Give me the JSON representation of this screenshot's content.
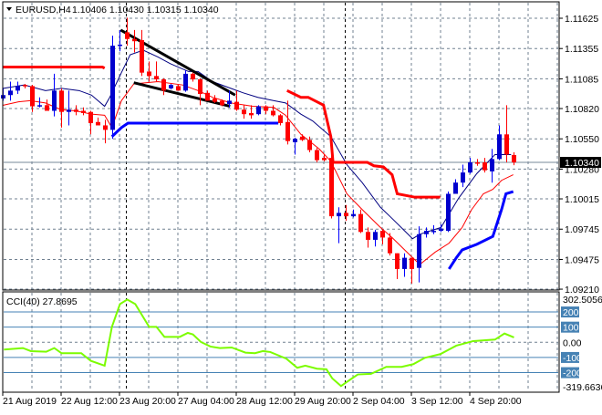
{
  "header": {
    "symbol": "EURUSD,H4",
    "ohlc": "1.10406 1.10430 1.10315 1.10340"
  },
  "price_axis": {
    "ticks": [
      "1.11625",
      "1.11355",
      "1.11085",
      "1.10820",
      "1.10550",
      "1.10280",
      "1.10015",
      "1.09745",
      "1.09475",
      "1.09210"
    ],
    "current_price_label": "1.10340"
  },
  "cci_panel": {
    "label": "CCI(40) 27.8695",
    "max_label": "302.5056",
    "min_label": "-319.6636",
    "level_labels": [
      "200",
      "100",
      "0.00",
      "-100",
      "-200"
    ]
  },
  "time_axis": {
    "labels": [
      "21 Aug 2019",
      "22 Aug 12:00",
      "23 Aug 20:00",
      "27 Aug 04:00",
      "28 Aug 12:00",
      "29 Aug 20:00",
      "2 Sep 04:00",
      "3 Sep 12:00",
      "4 Sep 20:00"
    ]
  },
  "colors": {
    "bull": "#0000CD",
    "bull_wick": "#0000FF",
    "bear": "#FF0000",
    "ma_fast": "#000080",
    "ma_slow": "#FF0000",
    "resistance": "#FF0000",
    "support": "#0000FF",
    "trendline": "#000000",
    "cci": "#7CFC00",
    "cci_levels": "#4682B4",
    "grid": "#708090"
  },
  "chart_data": {
    "type": "candlestick",
    "title": "EURUSD,H4",
    "ylim": [
      1.0921,
      1.11625
    ],
    "y_ticks": [
      1.11625,
      1.11355,
      1.11085,
      1.1082,
      1.1055,
      1.1028,
      1.10015,
      1.09745,
      1.09475,
      1.0921
    ],
    "current_price": 1.1034,
    "period_separators": [
      17,
      47
    ],
    "grid": true,
    "candles_ohlc": [
      [
        1.1091,
        1.11,
        1.1089,
        1.1094
      ],
      [
        1.1094,
        1.1106,
        1.1089,
        1.1098
      ],
      [
        1.1098,
        1.1106,
        1.1095,
        1.1102
      ],
      [
        1.1103,
        1.1104,
        1.11,
        1.1102
      ],
      [
        1.1102,
        1.1103,
        1.1079,
        1.1084
      ],
      [
        1.1084,
        1.1092,
        1.1083,
        1.1085
      ],
      [
        1.1085,
        1.109,
        1.108,
        1.108
      ],
      [
        1.108,
        1.1113,
        1.1075,
        1.1098
      ],
      [
        1.1098,
        1.11,
        1.1065,
        1.1079
      ],
      [
        1.1079,
        1.1098,
        1.1067,
        1.1081
      ],
      [
        1.1081,
        1.1085,
        1.1076,
        1.1079
      ],
      [
        1.108,
        1.1083,
        1.1076,
        1.1078
      ],
      [
        1.1079,
        1.108,
        1.1059,
        1.1069
      ],
      [
        1.107,
        1.1074,
        1.1067,
        1.1067
      ],
      [
        1.1067,
        1.1072,
        1.1051,
        1.1063
      ],
      [
        1.1063,
        1.1147,
        1.1055,
        1.1138
      ],
      [
        1.1138,
        1.1152,
        1.1133,
        1.1139
      ],
      [
        1.115,
        1.1163,
        1.1138,
        1.1144
      ],
      [
        1.1144,
        1.1152,
        1.1132,
        1.1142
      ],
      [
        1.1143,
        1.1152,
        1.1111,
        1.1114
      ],
      [
        1.1115,
        1.1124,
        1.1106,
        1.1111
      ],
      [
        1.1111,
        1.1124,
        1.1106,
        1.1108
      ],
      [
        1.1108,
        1.1109,
        1.1094,
        1.1098
      ],
      [
        1.11,
        1.1104,
        1.1099,
        1.1103
      ],
      [
        1.1102,
        1.1103,
        1.1098,
        1.1098
      ],
      [
        1.1098,
        1.1116,
        1.1097,
        1.1113
      ],
      [
        1.1113,
        1.1114,
        1.1106,
        1.1108
      ],
      [
        1.1108,
        1.1109,
        1.1085,
        1.1095
      ],
      [
        1.1096,
        1.1098,
        1.1089,
        1.1089
      ],
      [
        1.1091,
        1.1094,
        1.1087,
        1.1088
      ],
      [
        1.1089,
        1.109,
        1.1084,
        1.1085
      ],
      [
        1.1086,
        1.1098,
        1.1083,
        1.1089
      ],
      [
        1.1088,
        1.1098,
        1.108,
        1.1081
      ],
      [
        1.1081,
        1.1085,
        1.1073,
        1.1077
      ],
      [
        1.1078,
        1.1085,
        1.1073,
        1.1076
      ],
      [
        1.1077,
        1.1085,
        1.1076,
        1.1084
      ],
      [
        1.1084,
        1.1085,
        1.1077,
        1.108
      ],
      [
        1.108,
        1.1085,
        1.1075,
        1.1076
      ],
      [
        1.1076,
        1.1077,
        1.1067,
        1.1069
      ],
      [
        1.107,
        1.1089,
        1.105,
        1.1053
      ],
      [
        1.1052,
        1.1056,
        1.1041,
        1.1055
      ],
      [
        1.1057,
        1.1059,
        1.1053,
        1.1054
      ],
      [
        1.1054,
        1.1057,
        1.1043,
        1.1045
      ],
      [
        1.1045,
        1.1047,
        1.1034,
        1.1036
      ],
      [
        1.1038,
        1.1041,
        1.1035,
        1.1036
      ],
      [
        1.1038,
        1.1057,
        1.0984,
        1.0986
      ],
      [
        1.0986,
        1.0994,
        1.0962,
        1.0989
      ],
      [
        1.0989,
        1.0996,
        1.0982,
        1.0986
      ],
      [
        1.0986,
        1.0992,
        1.0985,
        1.0988
      ],
      [
        1.0988,
        1.0992,
        1.0971,
        1.0972
      ],
      [
        1.0972,
        1.0976,
        1.0958,
        1.0965
      ],
      [
        1.0965,
        1.0974,
        1.0959,
        1.0972
      ],
      [
        1.0973,
        1.0974,
        1.0961,
        1.0967
      ],
      [
        1.0967,
        1.0971,
        1.0951,
        1.0953
      ],
      [
        1.0953,
        1.0953,
        1.093,
        1.0939
      ],
      [
        1.0939,
        1.0953,
        1.0932,
        1.0949
      ],
      [
        1.0949,
        1.0949,
        1.0926,
        1.0939
      ],
      [
        1.094,
        1.0977,
        1.0927,
        1.097
      ],
      [
        1.097,
        1.0976,
        1.0967,
        1.0973
      ],
      [
        1.0972,
        1.0978,
        1.097,
        1.0973
      ],
      [
        1.0973,
        1.0979,
        1.0972,
        1.0975
      ],
      [
        1.0973,
        1.1008,
        1.0972,
        1.1006
      ],
      [
        1.1006,
        1.1019,
        1.1006,
        1.1016
      ],
      [
        1.1016,
        1.1032,
        1.1012,
        1.1025
      ],
      [
        1.1025,
        1.1038,
        1.1024,
        1.1034
      ],
      [
        1.1034,
        1.1037,
        1.1031,
        1.1033
      ],
      [
        1.1034,
        1.1038,
        1.1025,
        1.1027
      ],
      [
        1.1026,
        1.1046,
        1.1016,
        1.1037
      ],
      [
        1.1037,
        1.1067,
        1.1036,
        1.1059
      ],
      [
        1.1059,
        1.1085,
        1.1034,
        1.1041
      ],
      [
        1.10406,
        1.1043,
        1.10315,
        1.1034
      ]
    ],
    "lines": [
      {
        "name": "ma-fast",
        "points": [
          [
            0,
            1.11
          ],
          [
            2.9,
            1.1103
          ],
          [
            5.8,
            1.1098
          ],
          [
            8,
            1.11
          ],
          [
            10.4,
            1.1098
          ],
          [
            12.1,
            1.1094
          ],
          [
            13.9,
            1.1084
          ],
          [
            14.6,
            1.1092
          ],
          [
            16.2,
            1.1114
          ],
          [
            17.4,
            1.113
          ],
          [
            19.2,
            1.1134
          ],
          [
            21.2,
            1.1128
          ],
          [
            22.9,
            1.1122
          ],
          [
            25.4,
            1.1115
          ],
          [
            26.7,
            1.1115
          ],
          [
            28.7,
            1.1106
          ],
          [
            31.2,
            1.11
          ],
          [
            32.9,
            1.1096
          ],
          [
            34.9,
            1.1092
          ],
          [
            37.1,
            1.1089
          ],
          [
            38.7,
            1.1087
          ],
          [
            40.8,
            1.1077
          ],
          [
            42.4,
            1.1071
          ],
          [
            44.9,
            1.1057
          ],
          [
            47.1,
            1.1032
          ],
          [
            49.2,
            1.1016
          ],
          [
            51.7,
            1.0994
          ],
          [
            53.3,
            1.0984
          ],
          [
            56.1,
            1.0966
          ],
          [
            57.1,
            1.097
          ],
          [
            60,
            1.0976
          ],
          [
            62.4,
            1.1002
          ],
          [
            64.9,
            1.1024
          ],
          [
            67.4,
            1.1041
          ],
          [
            69.6,
            1.1041
          ]
        ]
      },
      {
        "name": "ma-slow",
        "points": [
          [
            0,
            1.1085
          ],
          [
            2.1,
            1.1088
          ],
          [
            3.7,
            1.1089
          ],
          [
            5.8,
            1.1087
          ],
          [
            7.9,
            1.1081
          ],
          [
            9.9,
            1.108
          ],
          [
            12.1,
            1.1077
          ],
          [
            13.9,
            1.1076
          ],
          [
            14.9,
            1.1065
          ],
          [
            16.2,
            1.1089
          ],
          [
            17.9,
            1.1104
          ],
          [
            21.2,
            1.1106
          ],
          [
            24.6,
            1.1103
          ],
          [
            26.7,
            1.1098
          ],
          [
            28.7,
            1.1092
          ],
          [
            31.2,
            1.1087
          ],
          [
            34.2,
            1.1084
          ],
          [
            37.1,
            1.1083
          ],
          [
            38.7,
            1.1076
          ],
          [
            40.8,
            1.1059
          ],
          [
            43.3,
            1.1046
          ],
          [
            44.9,
            1.1035
          ],
          [
            47.1,
            1.1006
          ],
          [
            49.2,
            1.0992
          ],
          [
            51.7,
            1.0976
          ],
          [
            53.3,
            1.0967
          ],
          [
            55.8,
            1.0951
          ],
          [
            57.1,
            1.0943
          ],
          [
            59.2,
            1.0954
          ],
          [
            61.1,
            1.0962
          ],
          [
            62.9,
            1.0976
          ],
          [
            64.2,
            1.0992
          ],
          [
            65.8,
            1.1006
          ],
          [
            67.1,
            1.101
          ],
          [
            68.3,
            1.1018
          ],
          [
            69.9,
            1.1023
          ]
        ]
      },
      {
        "name": "resistance-1",
        "points": [
          [
            0,
            1.1119
          ],
          [
            13.6,
            1.1119
          ],
          [
            13.9,
            1.1118
          ]
        ]
      },
      {
        "name": "resistance-2",
        "points": [
          [
            38.9,
            1.1098
          ],
          [
            40.8,
            1.1092
          ],
          [
            41.8,
            1.1092
          ],
          [
            43.9,
            1.1085
          ],
          [
            44.9,
            1.1057
          ],
          [
            45.2,
            1.1034
          ],
          [
            49.9,
            1.1034
          ],
          [
            50.8,
            1.1031
          ],
          [
            52.1,
            1.103
          ],
          [
            53.3,
            1.1023
          ],
          [
            54,
            1.1006
          ],
          [
            56.4,
            1.1003
          ],
          [
            59.9,
            1.1003
          ]
        ]
      },
      {
        "name": "support-1",
        "points": [
          [
            14.9,
            1.1057
          ],
          [
            16.2,
            1.1065
          ],
          [
            17.1,
            1.1069
          ],
          [
            37.7,
            1.1069
          ]
        ]
      },
      {
        "name": "support-2",
        "points": [
          [
            61.1,
            1.0939
          ],
          [
            62.1,
            1.0949
          ],
          [
            62.9,
            1.0956
          ],
          [
            64.9,
            1.0961
          ],
          [
            67.1,
            1.0968
          ],
          [
            68.3,
            1.0992
          ],
          [
            68.9,
            1.1006
          ],
          [
            69.9,
            1.1008
          ]
        ]
      },
      {
        "name": "trendline-upper",
        "points": [
          [
            16.1,
            1.1152
          ],
          [
            31.8,
            1.1094
          ]
        ]
      },
      {
        "name": "trendline-lower",
        "points": [
          [
            17.9,
            1.1105
          ],
          [
            31.1,
            1.1084
          ]
        ]
      }
    ],
    "cci": {
      "period": 40,
      "value": 27.8695,
      "ylim": [
        -319.6636,
        302.5056
      ],
      "levels": [
        200,
        100,
        0,
        -100,
        -200
      ],
      "points": [
        [
          0.1,
          -48
        ],
        [
          2.7,
          -38
        ],
        [
          3.8,
          -58
        ],
        [
          5.9,
          -62
        ],
        [
          7,
          -38
        ],
        [
          8,
          -72
        ],
        [
          10.7,
          -72
        ],
        [
          12,
          -122
        ],
        [
          13.9,
          -154
        ],
        [
          14.9,
          102
        ],
        [
          16,
          252
        ],
        [
          17,
          282
        ],
        [
          18.1,
          252
        ],
        [
          20,
          102
        ],
        [
          21,
          102
        ],
        [
          22.1,
          36
        ],
        [
          24.2,
          36
        ],
        [
          25.3,
          62
        ],
        [
          26,
          52
        ],
        [
          27.1,
          2
        ],
        [
          28.4,
          -28
        ],
        [
          29.7,
          -38
        ],
        [
          31.3,
          -34
        ],
        [
          33.2,
          -68
        ],
        [
          34.5,
          -72
        ],
        [
          35.6,
          -58
        ],
        [
          36.6,
          -64
        ],
        [
          38.8,
          -108
        ],
        [
          40.3,
          -168
        ],
        [
          41.4,
          -154
        ],
        [
          43,
          -174
        ],
        [
          44.3,
          -178
        ],
        [
          45.1,
          -238
        ],
        [
          46.3,
          -288
        ],
        [
          47.8,
          -238
        ],
        [
          48.6,
          -212
        ],
        [
          50.4,
          -208
        ],
        [
          52.5,
          -162
        ],
        [
          54.6,
          -162
        ],
        [
          56.2,
          -144
        ],
        [
          57.8,
          -102
        ],
        [
          59.9,
          -78
        ],
        [
          62.1,
          -22
        ],
        [
          64.4,
          8
        ],
        [
          67.4,
          18
        ],
        [
          68.7,
          58
        ],
        [
          70,
          32
        ]
      ]
    }
  }
}
